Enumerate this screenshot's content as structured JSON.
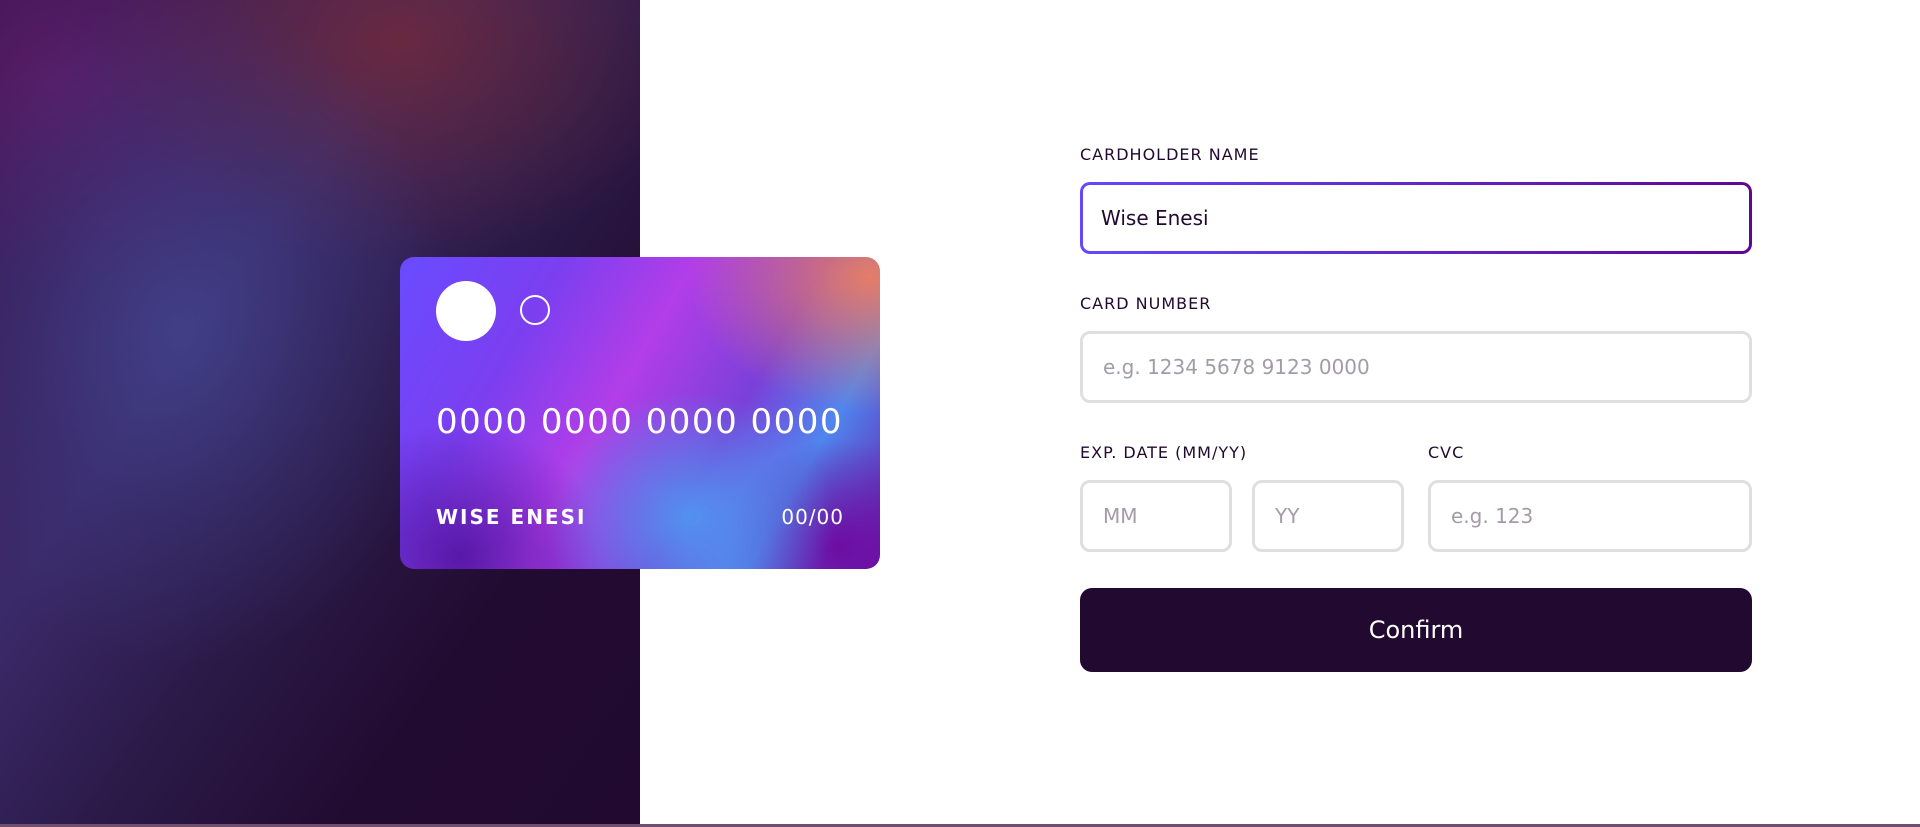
{
  "card": {
    "number": "0000 0000 0000 0000",
    "name": "WISE ENESI",
    "expiry": "00/00"
  },
  "form": {
    "name_label": "CARDHOLDER NAME",
    "name_value": "Wise Enesi",
    "number_label": "CARD NUMBER",
    "number_placeholder": "e.g. 1234 5678 9123 0000",
    "exp_label": "EXP. DATE (MM/YY)",
    "mm_placeholder": "MM",
    "yy_placeholder": "YY",
    "cvc_label": "CVC",
    "cvc_placeholder": "e.g. 123",
    "confirm_label": "Confirm"
  },
  "colors": {
    "dark": "#21092f",
    "accent_start": "#6448fe",
    "accent_end": "#600594",
    "input_border": "#dfdee0",
    "placeholder": "#a49ba8"
  }
}
